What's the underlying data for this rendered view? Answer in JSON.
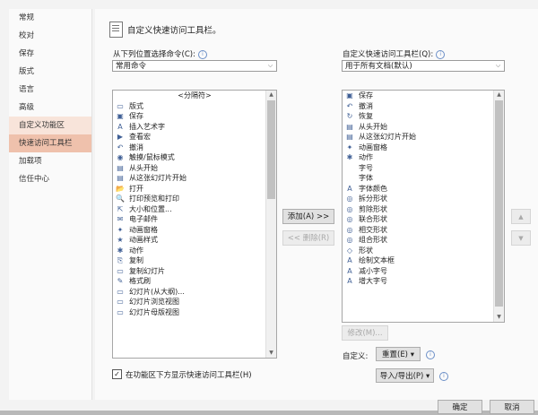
{
  "sidebar": {
    "items": [
      {
        "label": "常规"
      },
      {
        "label": "校对"
      },
      {
        "label": "保存"
      },
      {
        "label": "版式"
      },
      {
        "label": "语言"
      },
      {
        "label": "高级"
      },
      {
        "label": "自定义功能区"
      },
      {
        "label": "快速访问工具栏"
      },
      {
        "label": "加载项"
      },
      {
        "label": "信任中心"
      }
    ]
  },
  "header": {
    "title": "自定义快速访问工具栏。"
  },
  "left_panel": {
    "label": "从下列位置选择命令(C):",
    "dropdown_value": "常用命令",
    "items": [
      {
        "icon": "",
        "label": "<分隔符>"
      },
      {
        "icon": "▭",
        "label": "版式",
        "sub": "▸"
      },
      {
        "icon": "▣",
        "label": "保存"
      },
      {
        "icon": "A",
        "label": "插入艺术字",
        "sub": "▸"
      },
      {
        "icon": "▶",
        "label": "查看宏"
      },
      {
        "icon": "↶",
        "label": "撤消",
        "sub": "|▸"
      },
      {
        "icon": "◉",
        "label": "触摸/鼠标模式",
        "sub": "▸"
      },
      {
        "icon": "▤",
        "label": "从头开始"
      },
      {
        "icon": "▤",
        "label": "从这张幻灯片开始"
      },
      {
        "icon": "📂",
        "label": "打开"
      },
      {
        "icon": "🔍",
        "label": "打印预览和打印"
      },
      {
        "icon": "⇱",
        "label": "大小和位置..."
      },
      {
        "icon": "✉",
        "label": "电子邮件"
      },
      {
        "icon": "✦",
        "label": "动画窗格"
      },
      {
        "icon": "★",
        "label": "动画样式",
        "sub": "▸"
      },
      {
        "icon": "✱",
        "label": "动作"
      },
      {
        "icon": "⎘",
        "label": "复制"
      },
      {
        "icon": "▭",
        "label": "复制幻灯片"
      },
      {
        "icon": "✎",
        "label": "格式刷"
      },
      {
        "icon": "▭",
        "label": "幻灯片(从大纲)..."
      },
      {
        "icon": "▭",
        "label": "幻灯片浏览视图"
      },
      {
        "icon": "▭",
        "label": "幻灯片母版视图"
      }
    ]
  },
  "right_panel": {
    "label": "自定义快速访问工具栏(Q):",
    "dropdown_value": "用于所有文档(默认)",
    "items": [
      {
        "icon": "▣",
        "label": "保存"
      },
      {
        "icon": "↶",
        "label": "撤消",
        "sub": "|▸"
      },
      {
        "icon": "↻",
        "label": "恢复"
      },
      {
        "icon": "▤",
        "label": "从头开始"
      },
      {
        "icon": "▤",
        "label": "从这张幻灯片开始"
      },
      {
        "icon": "✦",
        "label": "动画窗格"
      },
      {
        "icon": "✱",
        "label": "动作"
      },
      {
        "icon": "",
        "label": "字号",
        "ctl": "I▾"
      },
      {
        "icon": "",
        "label": "字体",
        "ctl": "I▾"
      },
      {
        "icon": "A",
        "label": "字体颜色",
        "sub": "|▸"
      },
      {
        "icon": "◎",
        "label": "拆分形状"
      },
      {
        "icon": "◎",
        "label": "剪除形状"
      },
      {
        "icon": "◎",
        "label": "联合形状"
      },
      {
        "icon": "◎",
        "label": "相交形状"
      },
      {
        "icon": "◎",
        "label": "组合形状"
      },
      {
        "icon": "◇",
        "label": "形状",
        "sub": "▸"
      },
      {
        "icon": "A",
        "label": "绘制文本框"
      },
      {
        "icon": "A",
        "label": "减小字号"
      },
      {
        "icon": "A",
        "label": "增大字号"
      }
    ]
  },
  "buttons": {
    "add": "添加(A) >>",
    "remove": "<< 删除(R)",
    "modify": "修改(M)...",
    "reset": "重置(E) ▾",
    "import_export": "导入/导出(P) ▾",
    "ok": "确定",
    "cancel": "取消",
    "move_up": "▲",
    "move_down": "▼"
  },
  "customize_label": "自定义:",
  "show_below_ribbon": {
    "label": "在功能区下方显示快速访问工具栏(H)",
    "checked": true
  }
}
